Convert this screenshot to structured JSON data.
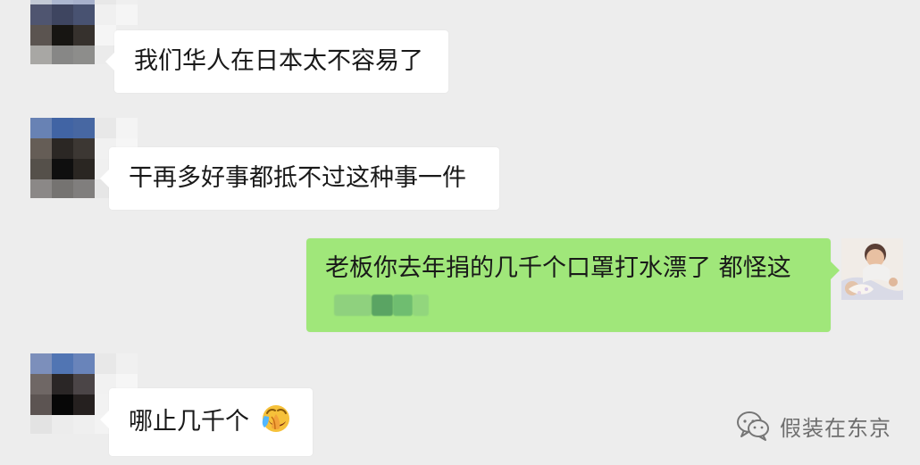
{
  "messages": [
    {
      "side": "left",
      "text": "我们华人在日本太不容易了"
    },
    {
      "side": "left",
      "text": "干再多好事都抵不过这种事一件"
    },
    {
      "side": "right",
      "text": "老板你去年捐的几千个口罩打水漂了 都怪这"
    },
    {
      "side": "left",
      "text": "哪止几千个"
    }
  ],
  "watermark": {
    "text": "假装在东京",
    "icon": "wechat-official-account-icon"
  },
  "emoji": {
    "name": "face-palm-emoji"
  },
  "colors": {
    "background": "#ededed",
    "incoming_bubble": "#ffffff",
    "outgoing_bubble": "#a0e77a",
    "text": "#191919",
    "watermark": "#6f6f6f"
  }
}
